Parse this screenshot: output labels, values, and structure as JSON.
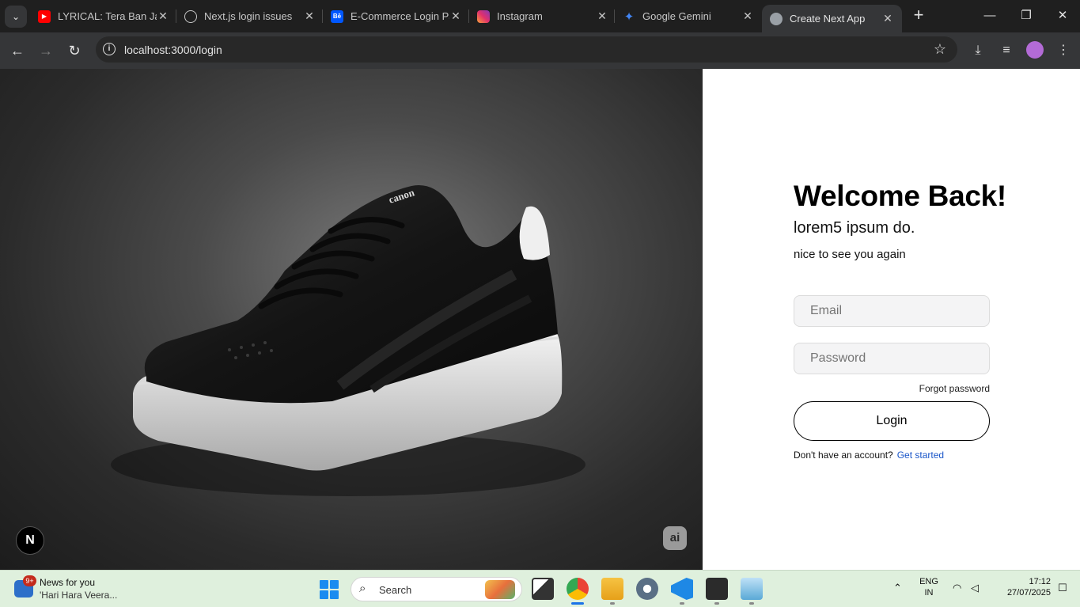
{
  "browser": {
    "tabs": [
      {
        "title": "LYRICAL: Tera Ban Jau",
        "favicon": "youtube-icon",
        "color": "#ff0000"
      },
      {
        "title": "Next.js login issues",
        "favicon": "openai-icon",
        "color": "#1f1f1f"
      },
      {
        "title": "E-Commerce Login Pa",
        "favicon": "behance-icon",
        "color": "#0057ff"
      },
      {
        "title": "Instagram",
        "favicon": "instagram-icon",
        "color": "#e1306c"
      },
      {
        "title": "Google Gemini",
        "favicon": "gemini-icon",
        "color": "#4285f4"
      },
      {
        "title": "Create Next App",
        "favicon": "globe-icon",
        "color": "#9aa0a6"
      }
    ],
    "url": "localhost:3000/login",
    "accent": "#353638"
  },
  "hero": {
    "image": "black-sneaker-photo",
    "shoe_brand_text": "canon",
    "badge_left": "N",
    "badge_right": "ai"
  },
  "login": {
    "title": "Welcome Back!",
    "subtitle": "lorem5 ipsum do.",
    "tagline": "nice to see you again",
    "email_placeholder": "Email",
    "password_placeholder": "Password",
    "forgot": "Forgot password",
    "submit": "Login",
    "no_account": "Don't have an account?",
    "get_started": "Get started",
    "link_color": "#1a56c9"
  },
  "taskbar": {
    "news_badge": "9+",
    "news_title": "News for you",
    "news_sub": "'Hari Hara Veera...",
    "search_label": "Search",
    "apps": [
      "task-view-icon",
      "chrome-icon",
      "file-explorer-icon",
      "settings-icon",
      "vscode-icon",
      "terminal-icon",
      "photos-icon"
    ],
    "lang_top": "ENG",
    "lang_bottom": "IN",
    "time": "17:12",
    "date": "27/07/2025"
  }
}
